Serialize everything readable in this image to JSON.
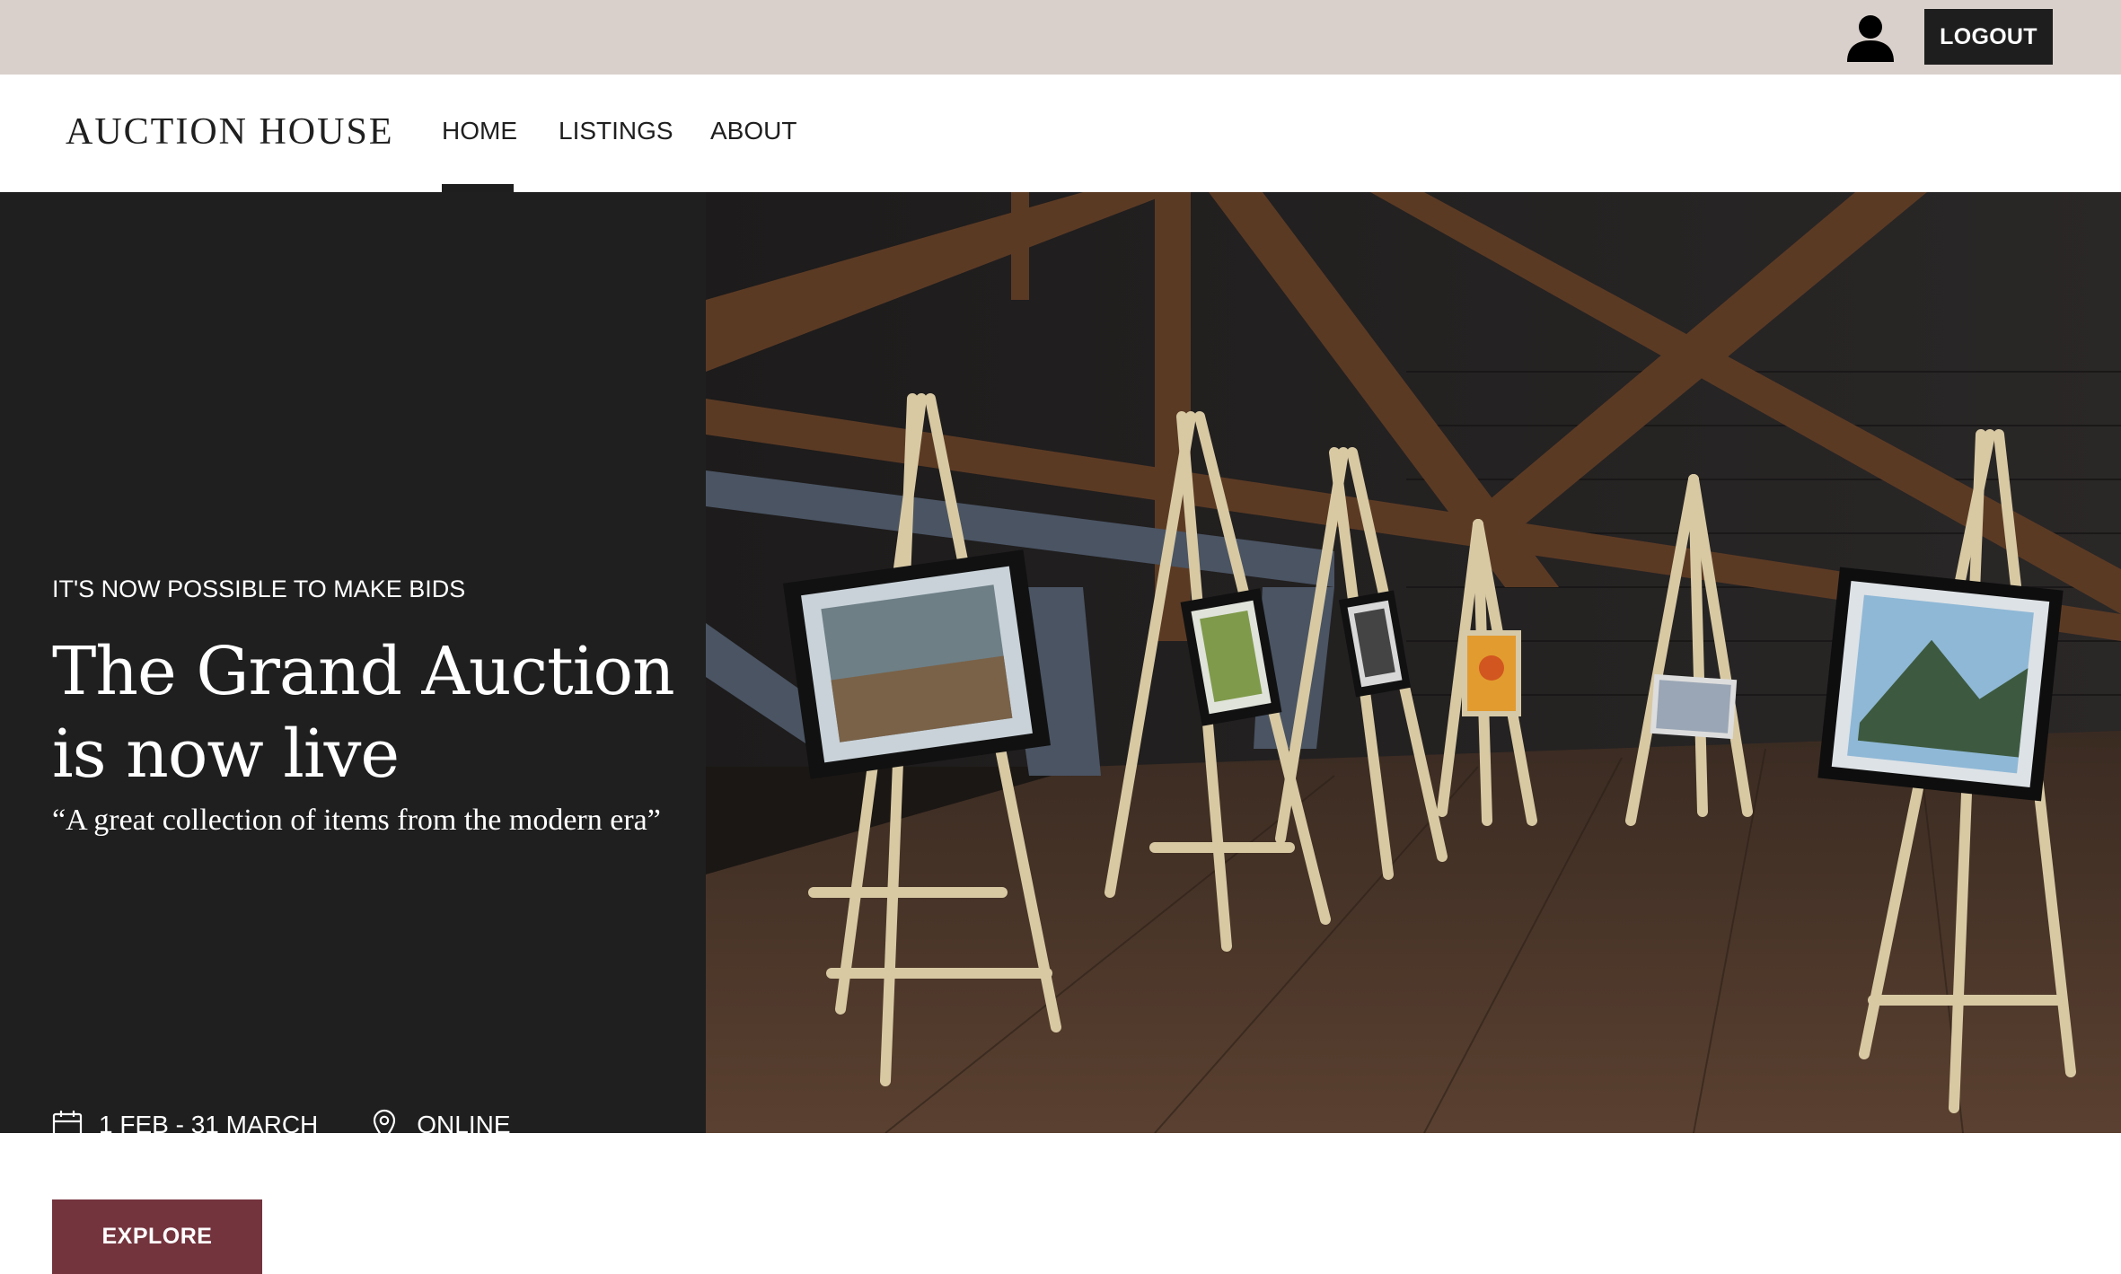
{
  "topbar": {
    "user_icon": "user-icon",
    "logout_label": "LOGOUT"
  },
  "nav": {
    "brand": "AUCTION HOUSE",
    "links": [
      "HOME",
      "LISTINGS",
      "ABOUT"
    ],
    "active": "HOME"
  },
  "hero": {
    "eyebrow": "IT'S NOW POSSIBLE TO MAKE BIDS",
    "title": "The Grand Auction is now live",
    "quote": "“A great collection of items from the modern era”",
    "date_icon": "calendar-icon",
    "dates": "1 FEB - 31 MARCH",
    "location_icon": "map-pin-icon",
    "location": "ONLINE",
    "cta_label": "EXPLORE",
    "image_subject": "art exhibition easels with framed paintings under wooden roof beams"
  },
  "colors": {
    "topbar_bg": "#d9d0cb",
    "dark_panel": "#1f1f1f",
    "accent_button": "#74343e",
    "logout_bg": "#1e1e1e"
  }
}
